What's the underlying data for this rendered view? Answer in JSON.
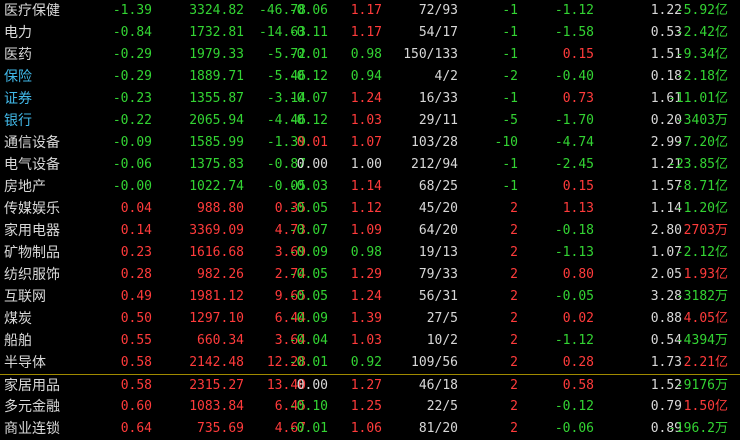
{
  "colors": {
    "up": "#ff3b3b",
    "down": "#33d433",
    "flat": "#d8d8d8",
    "blue_name": "#41b8e8",
    "separator": "#a08a00"
  },
  "rows": [
    {
      "name": "医疗保健",
      "blue": false,
      "chg": "-1.39",
      "price": "3324.82",
      "diff": "-46.78",
      "speed": "-0.06",
      "ratio": "1.17",
      "updown": "72/93",
      "lead": "-1",
      "lead_chg": "-1.12",
      "turnover": "1.22",
      "flow": "-5.92",
      "unit": "亿",
      "sep": false
    },
    {
      "name": "电力",
      "blue": false,
      "chg": "-0.84",
      "price": "1732.81",
      "diff": "-14.63",
      "speed": "-0.11",
      "ratio": "1.17",
      "updown": "54/17",
      "lead": "-1",
      "lead_chg": "-1.58",
      "turnover": "0.53",
      "flow": "-2.42",
      "unit": "亿",
      "sep": false
    },
    {
      "name": "医药",
      "blue": false,
      "chg": "-0.29",
      "price": "1979.33",
      "diff": "-5.72",
      "speed": "-0.01",
      "ratio": "0.98",
      "updown": "150/133",
      "lead": "-1",
      "lead_chg": "0.15",
      "turnover": "1.51",
      "flow": "-9.34",
      "unit": "亿",
      "sep": false
    },
    {
      "name": "保险",
      "blue": true,
      "chg": "-0.29",
      "price": "1889.71",
      "diff": "-5.46",
      "speed": "-0.12",
      "ratio": "0.94",
      "updown": "4/2",
      "lead": "-2",
      "lead_chg": "-0.40",
      "turnover": "0.18",
      "flow": "-2.18",
      "unit": "亿",
      "sep": false
    },
    {
      "name": "证券",
      "blue": true,
      "chg": "-0.23",
      "price": "1355.87",
      "diff": "-3.14",
      "speed": "-0.07",
      "ratio": "1.24",
      "updown": "16/33",
      "lead": "-1",
      "lead_chg": "0.73",
      "turnover": "1.61",
      "flow": "-11.01",
      "unit": "亿",
      "sep": false
    },
    {
      "name": "银行",
      "blue": true,
      "chg": "-0.22",
      "price": "2065.94",
      "diff": "-4.46",
      "speed": "-0.12",
      "ratio": "1.03",
      "updown": "29/11",
      "lead": "-5",
      "lead_chg": "-1.70",
      "turnover": "0.20",
      "flow": "-3403",
      "unit": "万",
      "sep": false
    },
    {
      "name": "通信设备",
      "blue": false,
      "chg": "-0.09",
      "price": "1585.99",
      "diff": "-1.39",
      "speed": "0.01",
      "ratio": "1.07",
      "updown": "103/28",
      "lead": "-10",
      "lead_chg": "-4.74",
      "turnover": "2.99",
      "flow": "-7.20",
      "unit": "亿",
      "sep": false
    },
    {
      "name": "电气设备",
      "blue": false,
      "chg": "-0.06",
      "price": "1375.83",
      "diff": "-0.87",
      "speed": "0.00",
      "ratio": "1.00",
      "updown": "212/94",
      "lead": "-1",
      "lead_chg": "-2.45",
      "turnover": "1.21",
      "flow": "-23.85",
      "unit": "亿",
      "sep": false
    },
    {
      "name": "房地产",
      "blue": false,
      "chg": "-0.00",
      "price": "1022.74",
      "diff": "-0.05",
      "speed": "-0.03",
      "ratio": "1.14",
      "updown": "68/25",
      "lead": "-1",
      "lead_chg": "0.15",
      "turnover": "1.57",
      "flow": "-8.71",
      "unit": "亿",
      "sep": false
    },
    {
      "name": "传媒娱乐",
      "blue": false,
      "chg": "0.04",
      "price": "988.80",
      "diff": "0.35",
      "speed": "-0.05",
      "ratio": "1.12",
      "updown": "45/20",
      "lead": "2",
      "lead_chg": "1.13",
      "turnover": "1.14",
      "flow": "-1.20",
      "unit": "亿",
      "sep": false
    },
    {
      "name": "家用电器",
      "blue": false,
      "chg": "0.14",
      "price": "3369.09",
      "diff": "4.73",
      "speed": "-0.07",
      "ratio": "1.09",
      "updown": "64/20",
      "lead": "2",
      "lead_chg": "-0.18",
      "turnover": "2.80",
      "flow": "2703",
      "unit": "万",
      "sep": false
    },
    {
      "name": "矿物制品",
      "blue": false,
      "chg": "0.23",
      "price": "1616.68",
      "diff": "3.69",
      "speed": "-0.09",
      "ratio": "0.98",
      "updown": "19/13",
      "lead": "2",
      "lead_chg": "-1.13",
      "turnover": "1.07",
      "flow": "-2.12",
      "unit": "亿",
      "sep": false
    },
    {
      "name": "纺织服饰",
      "blue": false,
      "chg": "0.28",
      "price": "982.26",
      "diff": "2.74",
      "speed": "-0.05",
      "ratio": "1.29",
      "updown": "79/33",
      "lead": "2",
      "lead_chg": "0.80",
      "turnover": "2.05",
      "flow": "1.93",
      "unit": "亿",
      "sep": false
    },
    {
      "name": "互联网",
      "blue": false,
      "chg": "0.49",
      "price": "1981.12",
      "diff": "9.65",
      "speed": "-0.05",
      "ratio": "1.24",
      "updown": "56/31",
      "lead": "2",
      "lead_chg": "-0.05",
      "turnover": "3.28",
      "flow": "-3182",
      "unit": "万",
      "sep": false
    },
    {
      "name": "煤炭",
      "blue": false,
      "chg": "0.50",
      "price": "1297.10",
      "diff": "6.44",
      "speed": "-0.09",
      "ratio": "1.39",
      "updown": "27/5",
      "lead": "2",
      "lead_chg": "0.02",
      "turnover": "0.88",
      "flow": "4.05",
      "unit": "亿",
      "sep": false
    },
    {
      "name": "船舶",
      "blue": false,
      "chg": "0.55",
      "price": "660.34",
      "diff": "3.64",
      "speed": "-0.04",
      "ratio": "1.03",
      "updown": "10/2",
      "lead": "2",
      "lead_chg": "-1.12",
      "turnover": "0.54",
      "flow": "-4394",
      "unit": "万",
      "sep": false
    },
    {
      "name": "半导体",
      "blue": false,
      "chg": "0.58",
      "price": "2142.48",
      "diff": "12.28",
      "speed": "-0.01",
      "ratio": "0.92",
      "updown": "109/56",
      "lead": "2",
      "lead_chg": "0.28",
      "turnover": "1.73",
      "flow": "2.21",
      "unit": "亿",
      "sep": false
    },
    {
      "name": "家居用品",
      "blue": false,
      "chg": "0.58",
      "price": "2315.27",
      "diff": "13.40",
      "speed": "0.00",
      "ratio": "1.27",
      "updown": "46/18",
      "lead": "2",
      "lead_chg": "0.58",
      "turnover": "1.52",
      "flow": "-9176",
      "unit": "万",
      "sep": true
    },
    {
      "name": "多元金融",
      "blue": false,
      "chg": "0.60",
      "price": "1083.84",
      "diff": "6.45",
      "speed": "-0.10",
      "ratio": "1.25",
      "updown": "22/5",
      "lead": "2",
      "lead_chg": "-0.12",
      "turnover": "0.79",
      "flow": "1.50",
      "unit": "亿",
      "sep": false
    },
    {
      "name": "商业连锁",
      "blue": false,
      "chg": "0.64",
      "price": "735.69",
      "diff": "4.67",
      "speed": "-0.01",
      "ratio": "1.06",
      "updown": "81/20",
      "lead": "2",
      "lead_chg": "-0.06",
      "turnover": "0.89",
      "flow": "-196.2",
      "unit": "万",
      "sep": false
    }
  ]
}
